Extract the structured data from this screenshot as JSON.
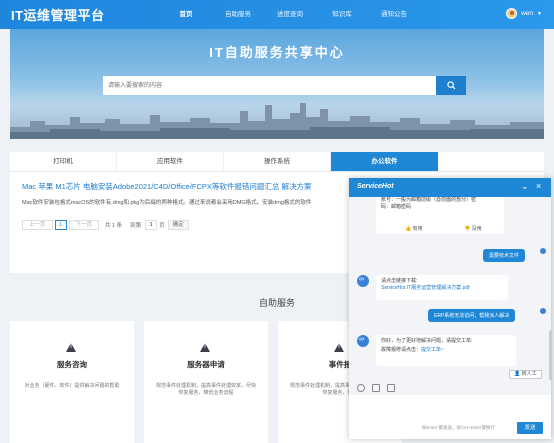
{
  "nav": {
    "logo": "IT运维管理平台",
    "items": [
      "首页",
      "自助服务",
      "进度查询",
      "知识库",
      "通知公告"
    ],
    "active_index": 0,
    "user": "wen"
  },
  "hero": {
    "title": "IT自助服务共享中心",
    "search_placeholder": "请输入要搜索的内容"
  },
  "kb": {
    "tabs": [
      "打印机",
      "应用软件",
      "操作系统",
      "办公软件"
    ],
    "active_tab": 3,
    "article_title": "Mac 苹果 M1芯片 电脑安装Adobe2021/C4D/Office/FCPX等软件报错问题汇总 解决方案",
    "article_desc": "Mac软件安装包格式macOS的软件有.dmg和.pkg为后缀的两种格式。通过来说都会采用DMG格式。安装dmg格式的软件",
    "pager": {
      "prev": "上一页",
      "page": "1",
      "next": "下一页",
      "total": "共 1 条",
      "goto": "到第",
      "goto_value": "1",
      "unit": "页",
      "confirm": "确定"
    }
  },
  "self_service": {
    "title": "自助服务",
    "cards": [
      {
        "title": "服务咨询",
        "desc": "对业务（硬件、软件）提供解决问题的帮助"
      },
      {
        "title": "服务器申请",
        "desc": "规范事件处理机制，提高事件处理效率，尽快恢复服务，降低业务流程"
      },
      {
        "title": "事件报",
        "desc": "规范事件处理机制，提高事件处理效率，尽快恢复服务，降低"
      }
    ]
  },
  "chat": {
    "brand": "ServiceHot",
    "brand_sub": "Service",
    "top_msg_line1": "账号：一般为邮箱前缀（@前面的部分）密",
    "top_msg_line2": "码：邮箱密码",
    "useful": "有用",
    "useless": "没用",
    "user_msg_1": "需要技术文件",
    "bot_msg_1_line1": "请点击链接下载:",
    "bot_msg_1_link": "ServiceHot IT服务运营管理解决方案.pdf",
    "user_msg_2": "ERP系统无法访问，帮我派人解决",
    "bot_msg_2_line1": "你好，为了更好地解决问题，请提交工单:",
    "bot_msg_2_prefix": "故障报修请点击：",
    "bot_msg_2_link": "提交工单~",
    "transfer": "转人工",
    "send_hint": "按Enter 键发送，按Ctrl+Enter键换行",
    "send": "发送"
  }
}
